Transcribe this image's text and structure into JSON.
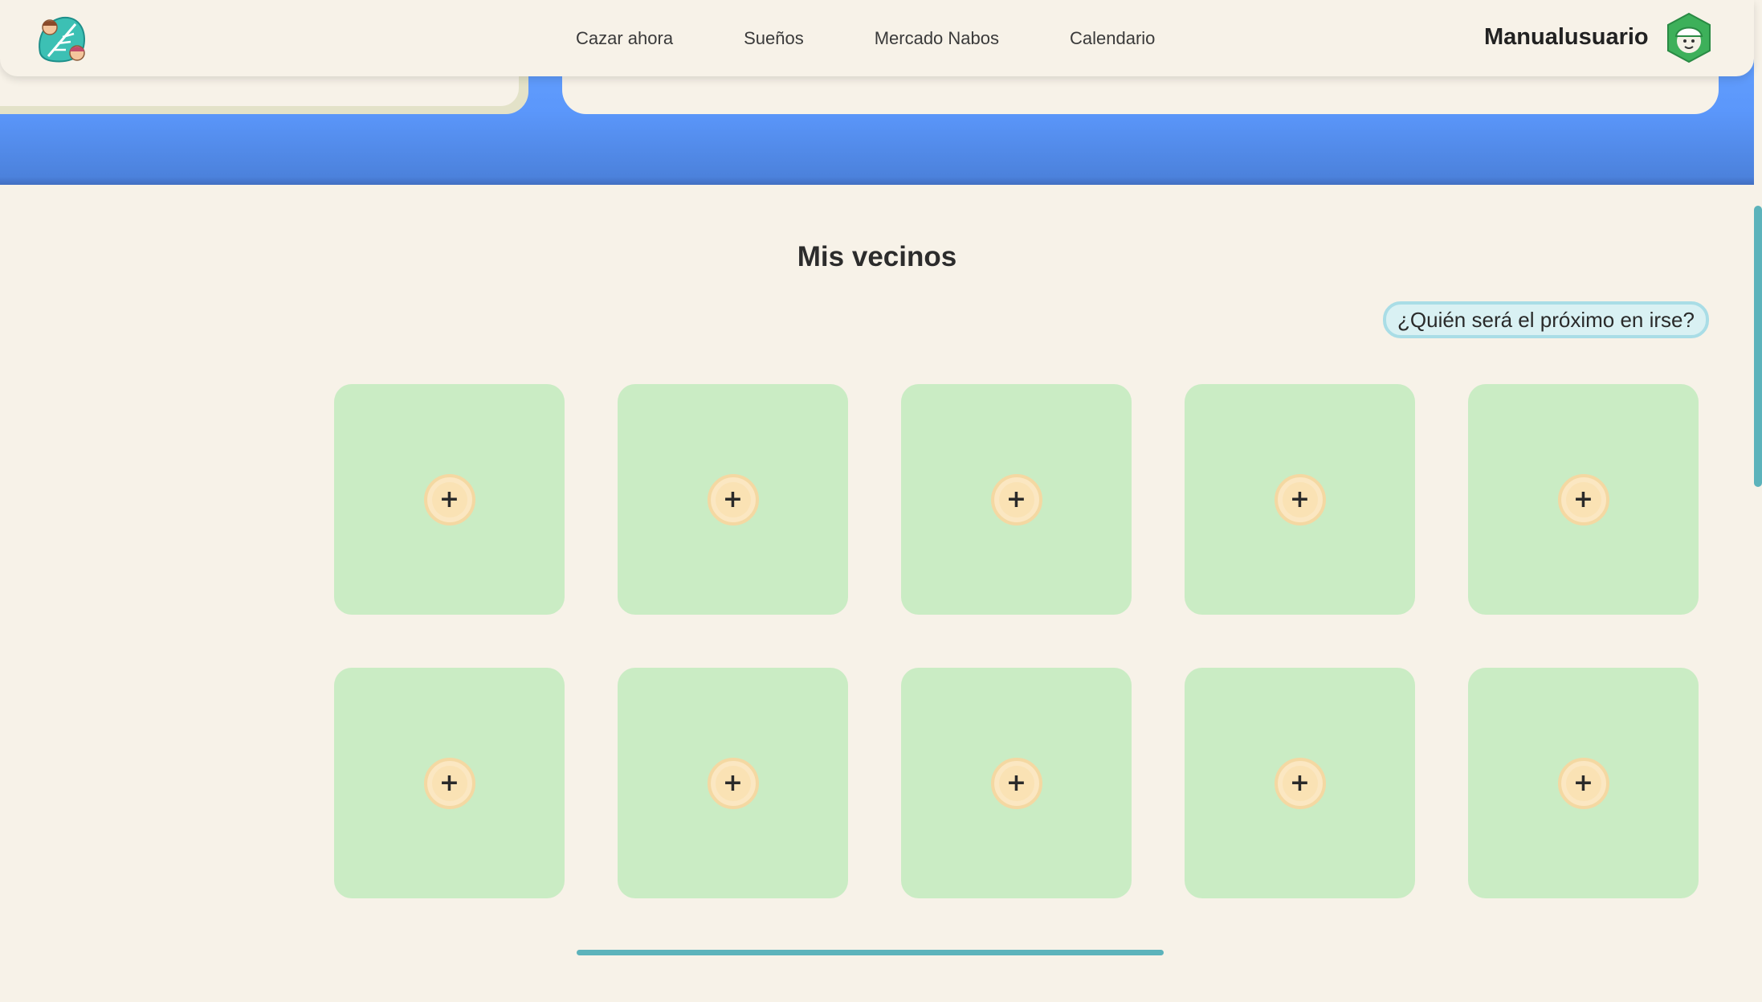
{
  "nav": {
    "links": [
      "Cazar ahora",
      "Sueños",
      "Mercado Nabos",
      "Calendario"
    ],
    "username": "Manualusuario",
    "logo_icon": "leaf-logo-icon",
    "avatar_icon": "villager-avatar-icon"
  },
  "main": {
    "title": "Mis vecinos",
    "next_button_label": "¿Quién será el próximo en irse?",
    "add_label": "+",
    "slots": [
      {
        "label": "+"
      },
      {
        "label": "+"
      },
      {
        "label": "+"
      },
      {
        "label": "+"
      },
      {
        "label": "+"
      },
      {
        "label": "+"
      },
      {
        "label": "+"
      },
      {
        "label": "+"
      },
      {
        "label": "+"
      },
      {
        "label": "+"
      }
    ]
  },
  "colors": {
    "background": "#f7f2e8",
    "sky": "#5b97fb",
    "slot": "#caecc4",
    "accent": "#5cb3bb",
    "add_button": "#fae2b4"
  }
}
